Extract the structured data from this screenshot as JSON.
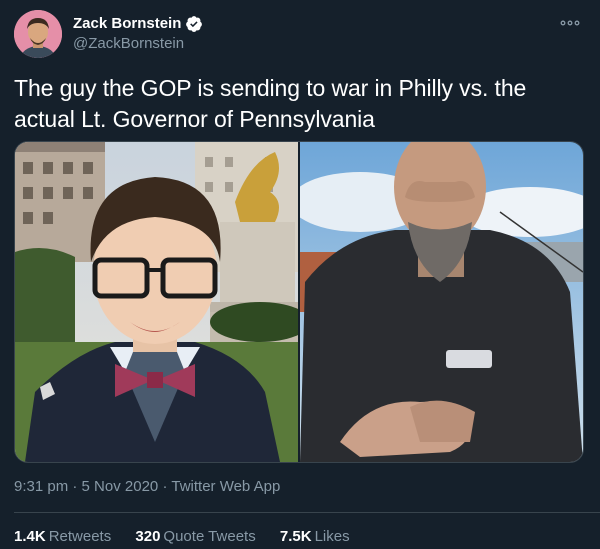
{
  "author": {
    "display_name": "Zack Bornstein",
    "handle": "@ZackBornstein",
    "verified": true,
    "avatar_icon": "person-avatar-icon"
  },
  "tweet": {
    "text": "The guy the GOP is sending to war in Philly vs. the actual Lt. Governor of Pennsylvania",
    "media": [
      {
        "description_icon": "photo-young-man-bowtie-icon"
      },
      {
        "description_icon": "photo-bald-bearded-man-icon"
      }
    ]
  },
  "meta": {
    "time": "9:31 pm",
    "separator": "·",
    "date": "5 Nov 2020",
    "source": "Twitter Web App"
  },
  "stats": {
    "retweets_count": "1.4K",
    "retweets_label": "Retweets",
    "quote_count": "320",
    "quote_label": "Quote Tweets",
    "likes_count": "7.5K",
    "likes_label": "Likes"
  },
  "colors": {
    "background": "#15202b",
    "secondary_text": "#8899a6",
    "verified_blue": "#1da1f2",
    "divider": "#38444d"
  }
}
